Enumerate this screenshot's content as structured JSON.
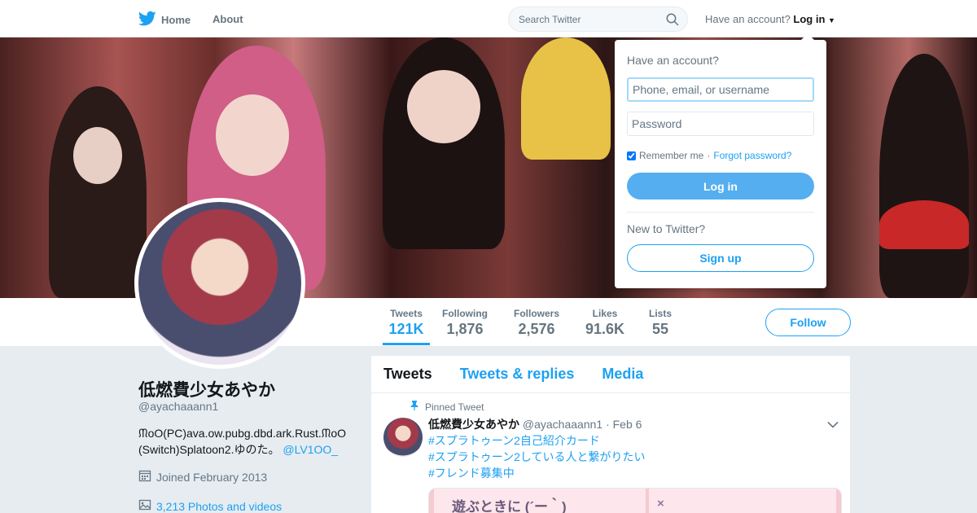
{
  "nav": {
    "home_label": "Home",
    "about_label": "About",
    "search_placeholder": "Search Twitter",
    "have_account": "Have an account?",
    "login_label": "Log in"
  },
  "profile": {
    "name": "低燃費少女あやか",
    "handle": "@ayachaaann1",
    "bio_text": "ᙏoO(PC)ava.ow.pubg.dbd.ark.Rust.ᙏoO (Switch)Splatoon2.ゆのた。",
    "bio_link": "@LV1OO_",
    "joined": "Joined February 2013",
    "photos": "3,213 Photos and videos"
  },
  "stats": [
    {
      "label": "Tweets",
      "value": "121K"
    },
    {
      "label": "Following",
      "value": "1,876"
    },
    {
      "label": "Followers",
      "value": "2,576"
    },
    {
      "label": "Likes",
      "value": "91.6K"
    },
    {
      "label": "Lists",
      "value": "55"
    }
  ],
  "follow_label": "Follow",
  "timeline": {
    "tabs": [
      "Tweets",
      "Tweets & replies",
      "Media"
    ],
    "pinned_label": "Pinned Tweet",
    "tweet": {
      "name": "低燃費少女あやか",
      "meta": "@ayachaaann1 · Feb 6",
      "lines": [
        "#スプラトゥーン2自己紹介カード",
        "#スプラトゥーン2している人と繋がりたい",
        "#フレンド募集中"
      ],
      "media_text": "遊ぶときに (´ー｀)",
      "media_x": "×"
    }
  },
  "login_dropdown": {
    "title": "Have an account?",
    "username_placeholder": "Phone, email, or username",
    "password_placeholder": "Password",
    "remember": "Remember me",
    "separator": " · ",
    "forgot": "Forgot password?",
    "login_button": "Log in",
    "new_to": "New to Twitter?",
    "signup_button": "Sign up"
  },
  "colors": {
    "accent": "#1da1f2",
    "login_button": "#55aef0"
  },
  "icons": {
    "logo": "twitter-bird-icon",
    "search": "search-icon",
    "calendar": "calendar-icon",
    "photo": "photo-icon",
    "pin": "pin-icon",
    "caret": "chevron-down-icon"
  }
}
